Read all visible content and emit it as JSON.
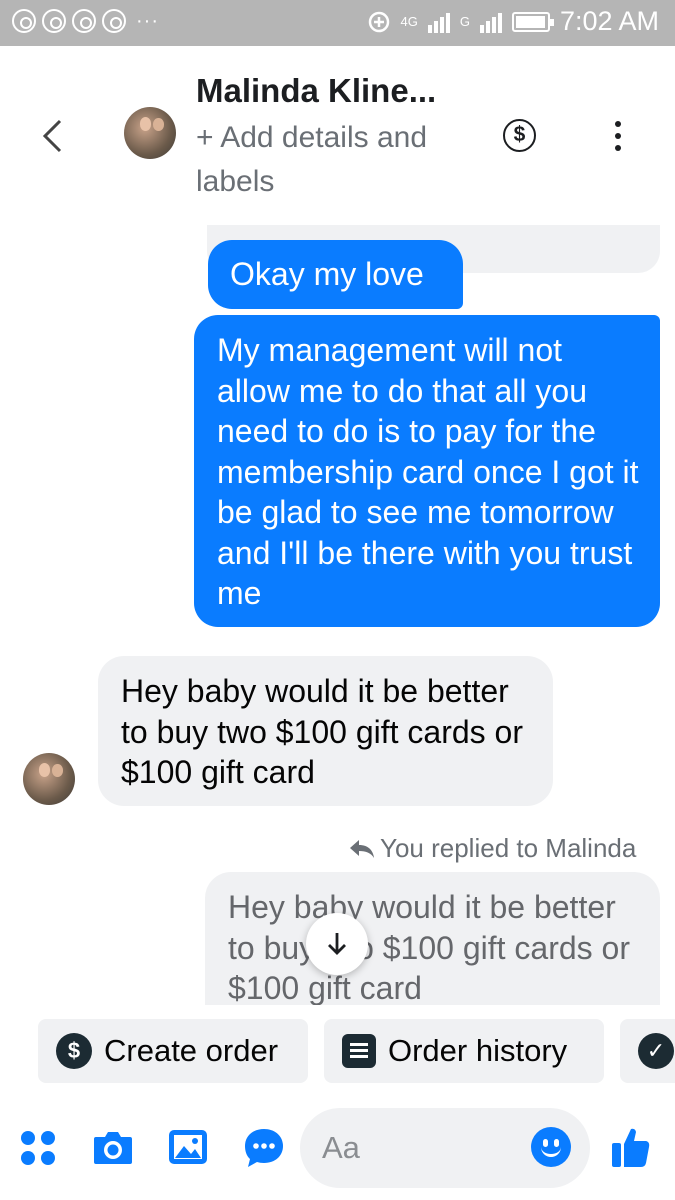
{
  "status_bar": {
    "network_label": "4G",
    "network_label_2": "G",
    "time": "7:02 AM"
  },
  "header": {
    "contact_name": "Malinda Kline...",
    "subtitle": "+ Add details and labels"
  },
  "messages": [
    {
      "direction": "outgoing",
      "text": "Okay my love"
    },
    {
      "direction": "outgoing",
      "text": "My management will not allow me to do that all you need to do is to pay for the membership card once I got it be glad to see me tomorrow and I'll be there with you trust me"
    },
    {
      "direction": "incoming",
      "text": "Hey baby would it be better to buy two $100 gift cards or $100 gift card"
    },
    {
      "direction": "outgoing-quote",
      "reply_note": "You replied to Malinda",
      "text": "Hey baby would it be better to buy two $100 gift cards or $100 gift card"
    }
  ],
  "chips": {
    "create_order": "Create order",
    "order_history": "Order history"
  },
  "composer": {
    "placeholder": "Aa"
  },
  "colors": {
    "accent": "#0a7cff",
    "incoming_bubble": "#f0f1f3",
    "status_bar": "#b5b5b5"
  }
}
